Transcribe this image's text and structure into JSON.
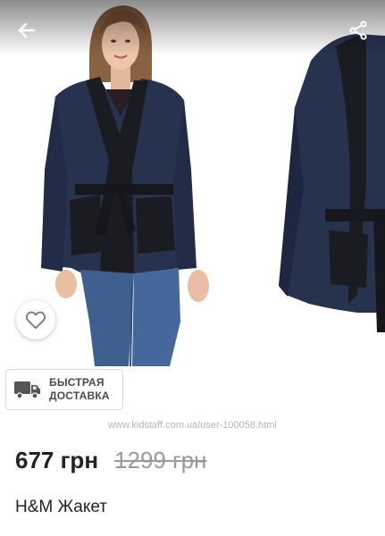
{
  "gallery": {
    "images": [
      {
        "alt": "model-wearing-navy-jacket"
      },
      {
        "alt": "navy-jacket-product-photo"
      }
    ]
  },
  "header": {
    "back_icon": "arrow-left-icon",
    "share_icon": "share-icon"
  },
  "favorite": {
    "icon": "heart-outline-icon"
  },
  "delivery": {
    "line1": "БЫСТРАЯ",
    "line2": "ДОСТАВКА",
    "icon": "truck-icon"
  },
  "watermark": "www.kidstaff.com.ua/user-100058.html",
  "product": {
    "price": "677 грн",
    "old_price": "1299 грн",
    "title": "H&M Жакет"
  },
  "colors": {
    "jacket_navy": "#27324f",
    "jacket_black": "#1b1c22",
    "jeans": "#3f5f8e",
    "text": "#222222",
    "old_price": "#9a9a9a"
  }
}
